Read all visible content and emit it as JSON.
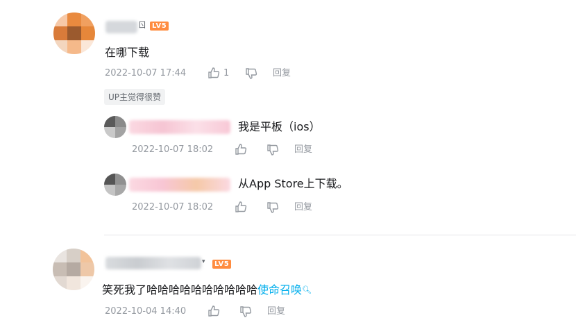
{
  "colors": {
    "accent": "#00aeec",
    "level_badge": "#ff8c40",
    "meta_text": "#9499a0",
    "divider": "#e3e5e7"
  },
  "comments": [
    {
      "name_suffix": "ㄖ",
      "level": "LV5",
      "text": "在哪下载",
      "time": "2022-10-07 17:44",
      "likes": "1",
      "reply_label": "回复",
      "tag": "UP主觉得很赞",
      "replies": [
        {
          "text": "我是平板（ios）",
          "time": "2022-10-07 18:02",
          "reply_label": "回复"
        },
        {
          "text": "从App Store上下载。",
          "time": "2022-10-07 18:02",
          "reply_label": "回复"
        }
      ]
    },
    {
      "name_suffix": "▾",
      "level": "LV5",
      "text_prefix": "笑死我了哈哈哈哈哈哈哈哈哈哈",
      "text_link": "使命召唤",
      "time": "2022-10-04 14:40",
      "reply_label": "回复"
    }
  ]
}
